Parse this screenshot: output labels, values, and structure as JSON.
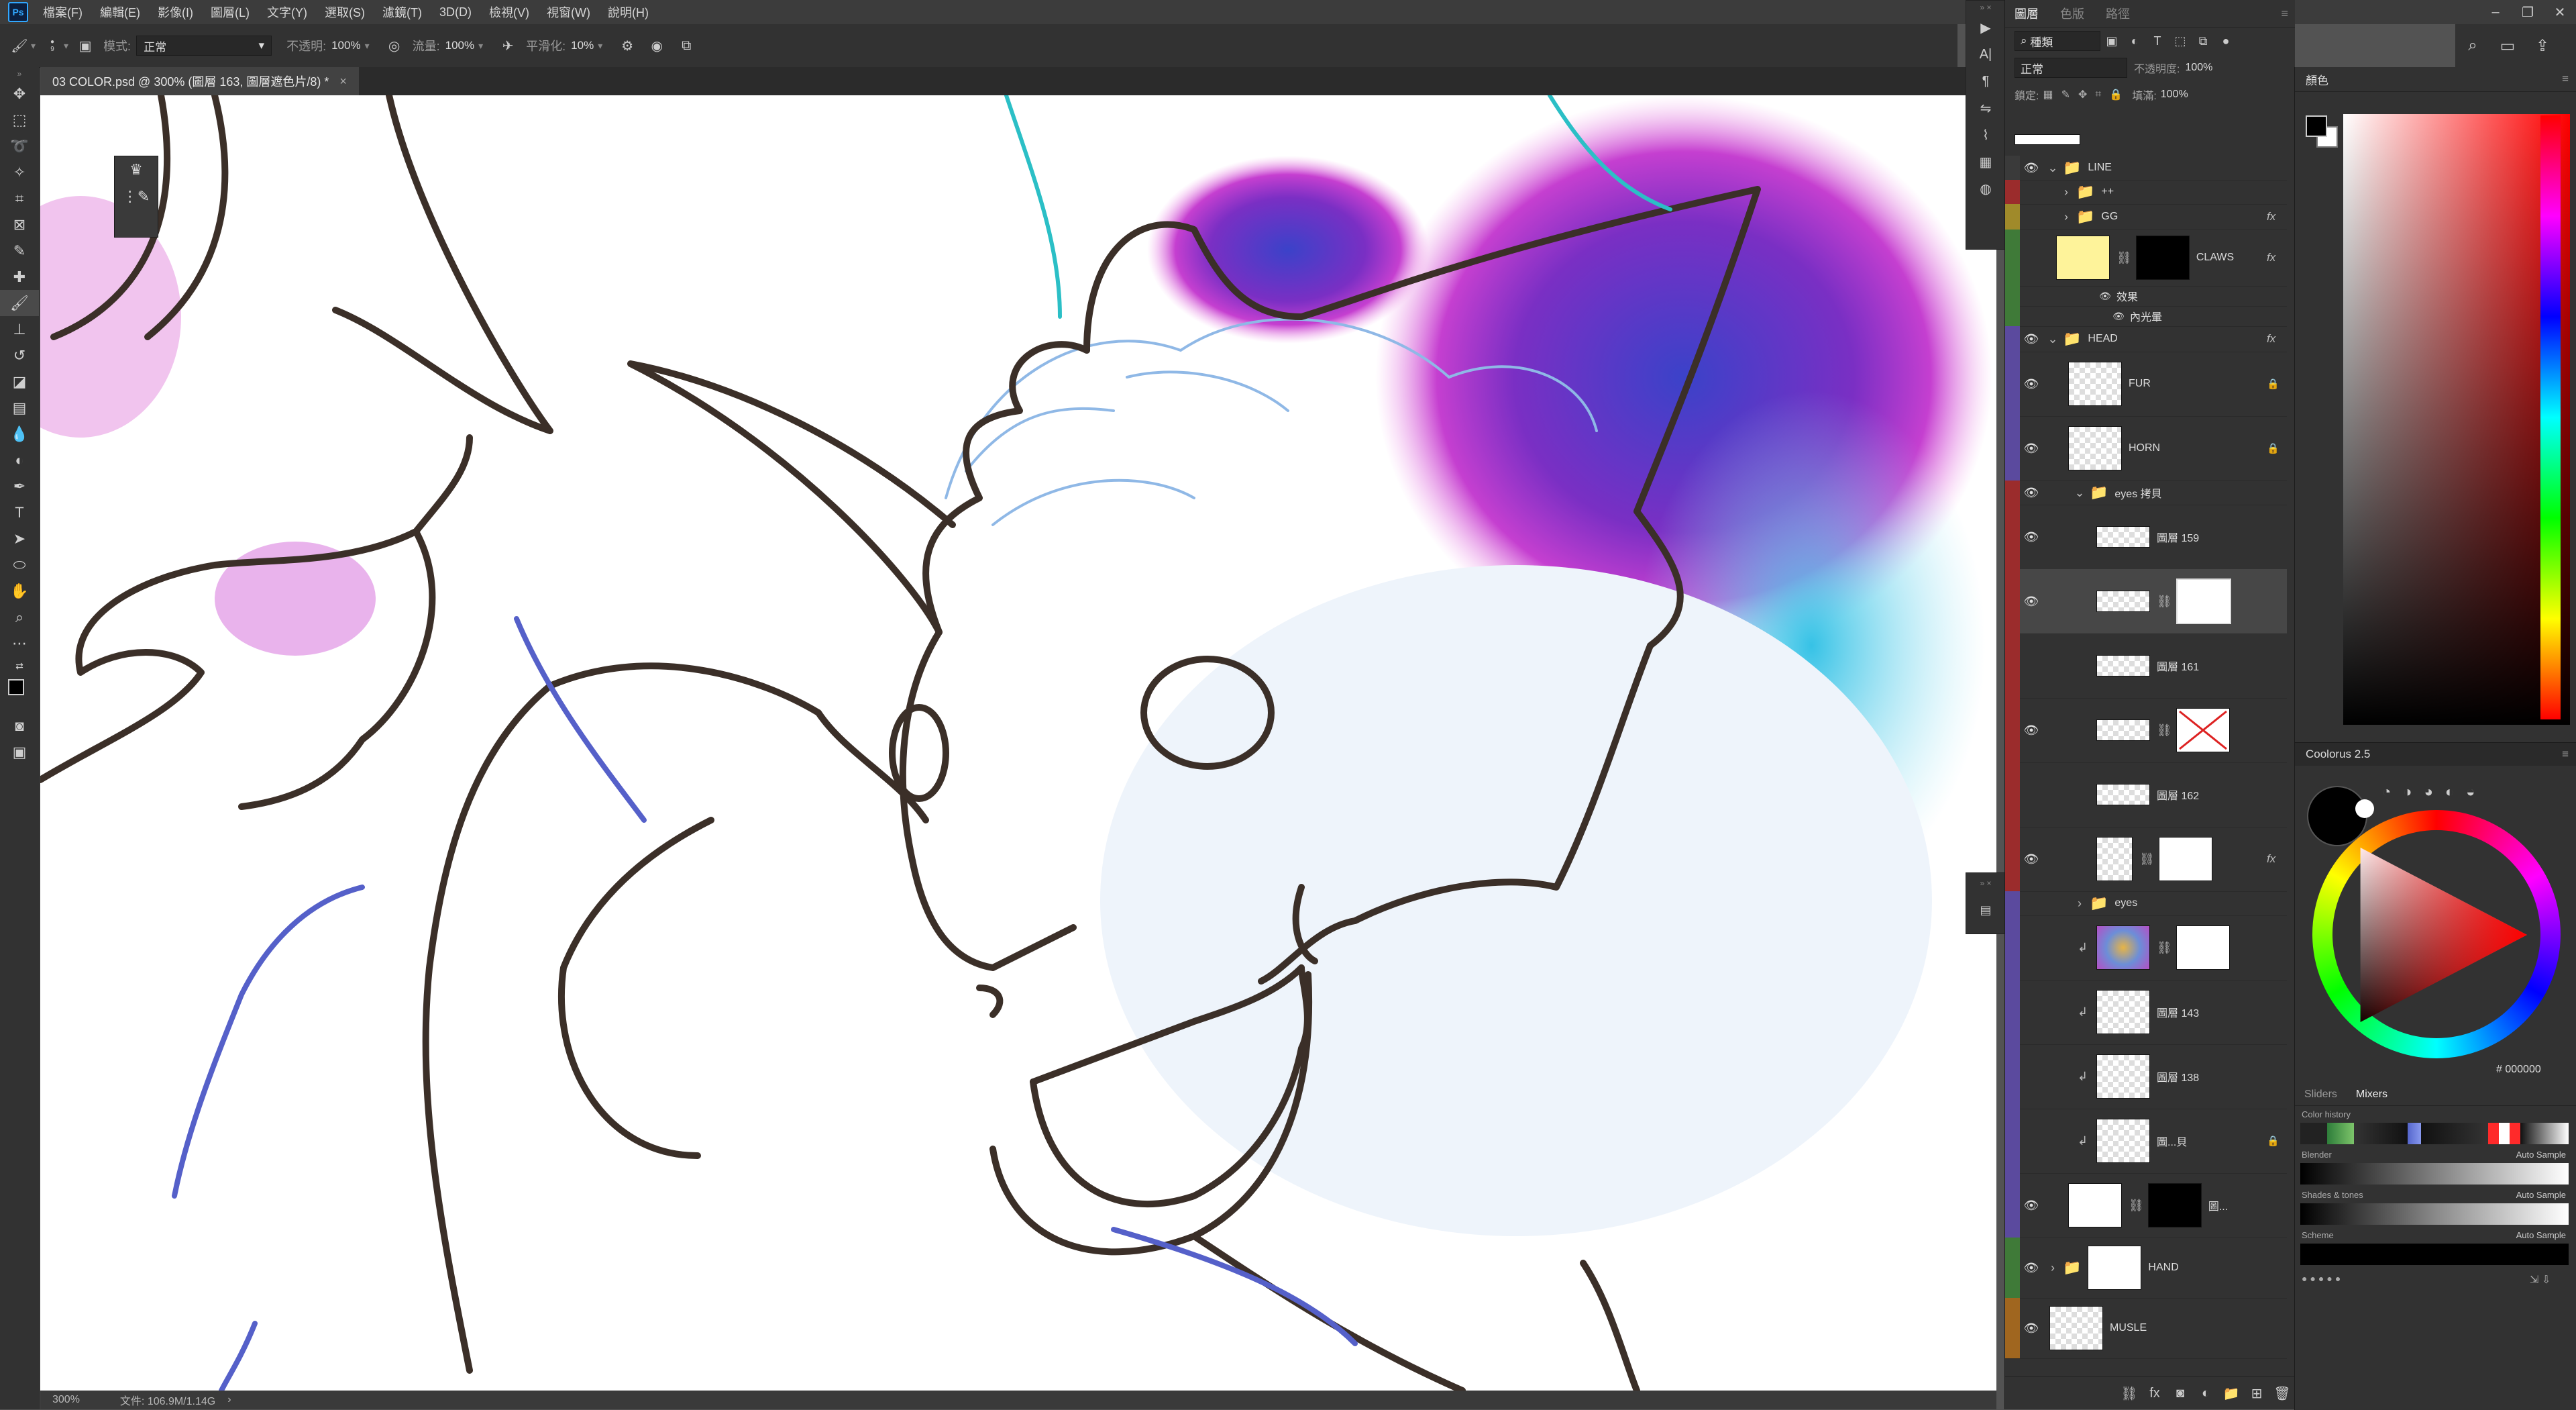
{
  "app": {
    "menu": [
      "檔案(F)",
      "編輯(E)",
      "影像(I)",
      "圖層(L)",
      "文字(Y)",
      "選取(S)",
      "濾鏡(T)",
      "3D(D)",
      "檢視(V)",
      "視窗(W)",
      "說明(H)"
    ],
    "logo": "Ps"
  },
  "options_bar": {
    "brush_size": "9",
    "mode_label": "模式:",
    "mode_value": "正常",
    "opacity_label": "不透明:",
    "opacity_value": "100%",
    "flow_label": "流量:",
    "flow_value": "100%",
    "smoothing_label": "平滑化:",
    "smoothing_value": "10%"
  },
  "document": {
    "tab_title": "03 COLOR.psd @ 300% (圖層 163, 圖層遮色片/8) *",
    "zoom": "300%",
    "file_info": "文件: 106.9M/1.14G"
  },
  "layers_panel": {
    "tabs": [
      "圖層",
      "色版",
      "路徑"
    ],
    "filter_kind": "種類",
    "blend_mode": "正常",
    "opacity_label": "不透明度:",
    "opacity_value": "100%",
    "lock_label": "鎖定:",
    "fill_label": "填滿:",
    "fill_value": "100%",
    "layers": [
      {
        "name": "LINE",
        "type": "group",
        "color": "#3a3a3a",
        "visible": true
      },
      {
        "name": "++",
        "type": "group",
        "color": "#9b2c2c",
        "visible": false
      },
      {
        "name": "GG",
        "type": "group",
        "color": "#a08a2a",
        "visible": false,
        "fx": "fx"
      },
      {
        "name": "CLAWS",
        "type": "layer",
        "color": "#3f7a38",
        "visible": false,
        "fx": "fx",
        "thumb": "#fef39a",
        "mask": "#000000"
      },
      {
        "name": "效果",
        "type": "effect",
        "color": "#3f7a38"
      },
      {
        "name": "內光暈",
        "type": "effect",
        "color": "#3f7a38"
      },
      {
        "name": "HEAD",
        "type": "group",
        "color": "#5b4a9e",
        "visible": true,
        "fx": "fx"
      },
      {
        "name": "FUR",
        "type": "layer",
        "color": "#5b4a9e",
        "visible": true,
        "lock": "lock"
      },
      {
        "name": "HORN",
        "type": "layer",
        "color": "#5b4a9e",
        "visible": true,
        "lock": "lock"
      },
      {
        "name": "eyes 拷貝",
        "type": "group",
        "color": "#9b2c2c",
        "visible": true
      },
      {
        "name": "圖層 159",
        "type": "layer",
        "color": "#9b2c2c",
        "visible": true
      },
      {
        "name": "",
        "type": "layer",
        "color": "#9b2c2c",
        "visible": true,
        "selected": true,
        "mask": "#ffffff"
      },
      {
        "name": "圖層 161",
        "type": "layer",
        "color": "#9b2c2c",
        "visible": false
      },
      {
        "name": "",
        "type": "layer",
        "color": "#9b2c2c",
        "visible": true,
        "mask": "#ffffff"
      },
      {
        "name": "圖層 162",
        "type": "layer",
        "color": "#9b2c2c",
        "visible": false
      },
      {
        "name": "",
        "type": "layer",
        "color": "#9b2c2c",
        "visible": true,
        "mask": "#ffffff",
        "fx": "fx"
      },
      {
        "name": "eyes",
        "type": "group",
        "color": "#5b4a9e",
        "visible": false
      },
      {
        "name": "",
        "type": "layer",
        "color": "#5b4a9e",
        "visible": false,
        "mask": "#ffffff"
      },
      {
        "name": "圖層 143",
        "type": "layer",
        "color": "#5b4a9e",
        "visible": false
      },
      {
        "name": "圖層 138",
        "type": "layer",
        "color": "#5b4a9e",
        "visible": false
      },
      {
        "name": "圖...貝",
        "type": "layer",
        "color": "#5b4a9e",
        "visible": false,
        "lock": "lock"
      },
      {
        "name": "圖...",
        "type": "layer",
        "color": "#5b4a9e",
        "visible": true,
        "mask": "#000000",
        "thumb": "#ffffff"
      },
      {
        "name": "HAND",
        "type": "group",
        "color": "#3f7a38",
        "visible": true
      },
      {
        "name": "MUSLE",
        "type": "layer",
        "color": "#a0661f",
        "visible": true
      }
    ]
  },
  "color_panel": {
    "title": "顏色",
    "foreground": "#000000",
    "background": "#ffffff",
    "hue": "#ff0000"
  },
  "coolorus": {
    "title": "Coolorus 2.5",
    "tabs": [
      "Sliders",
      "Mixers"
    ],
    "hex": "# 000000",
    "mixers": [
      {
        "label": "Color history"
      },
      {
        "label": "Blender",
        "auto": "Auto Sample"
      },
      {
        "label": "Shades & tones",
        "auto": "Auto Sample"
      },
      {
        "label": "Scheme",
        "auto": "Auto Sample"
      }
    ]
  }
}
